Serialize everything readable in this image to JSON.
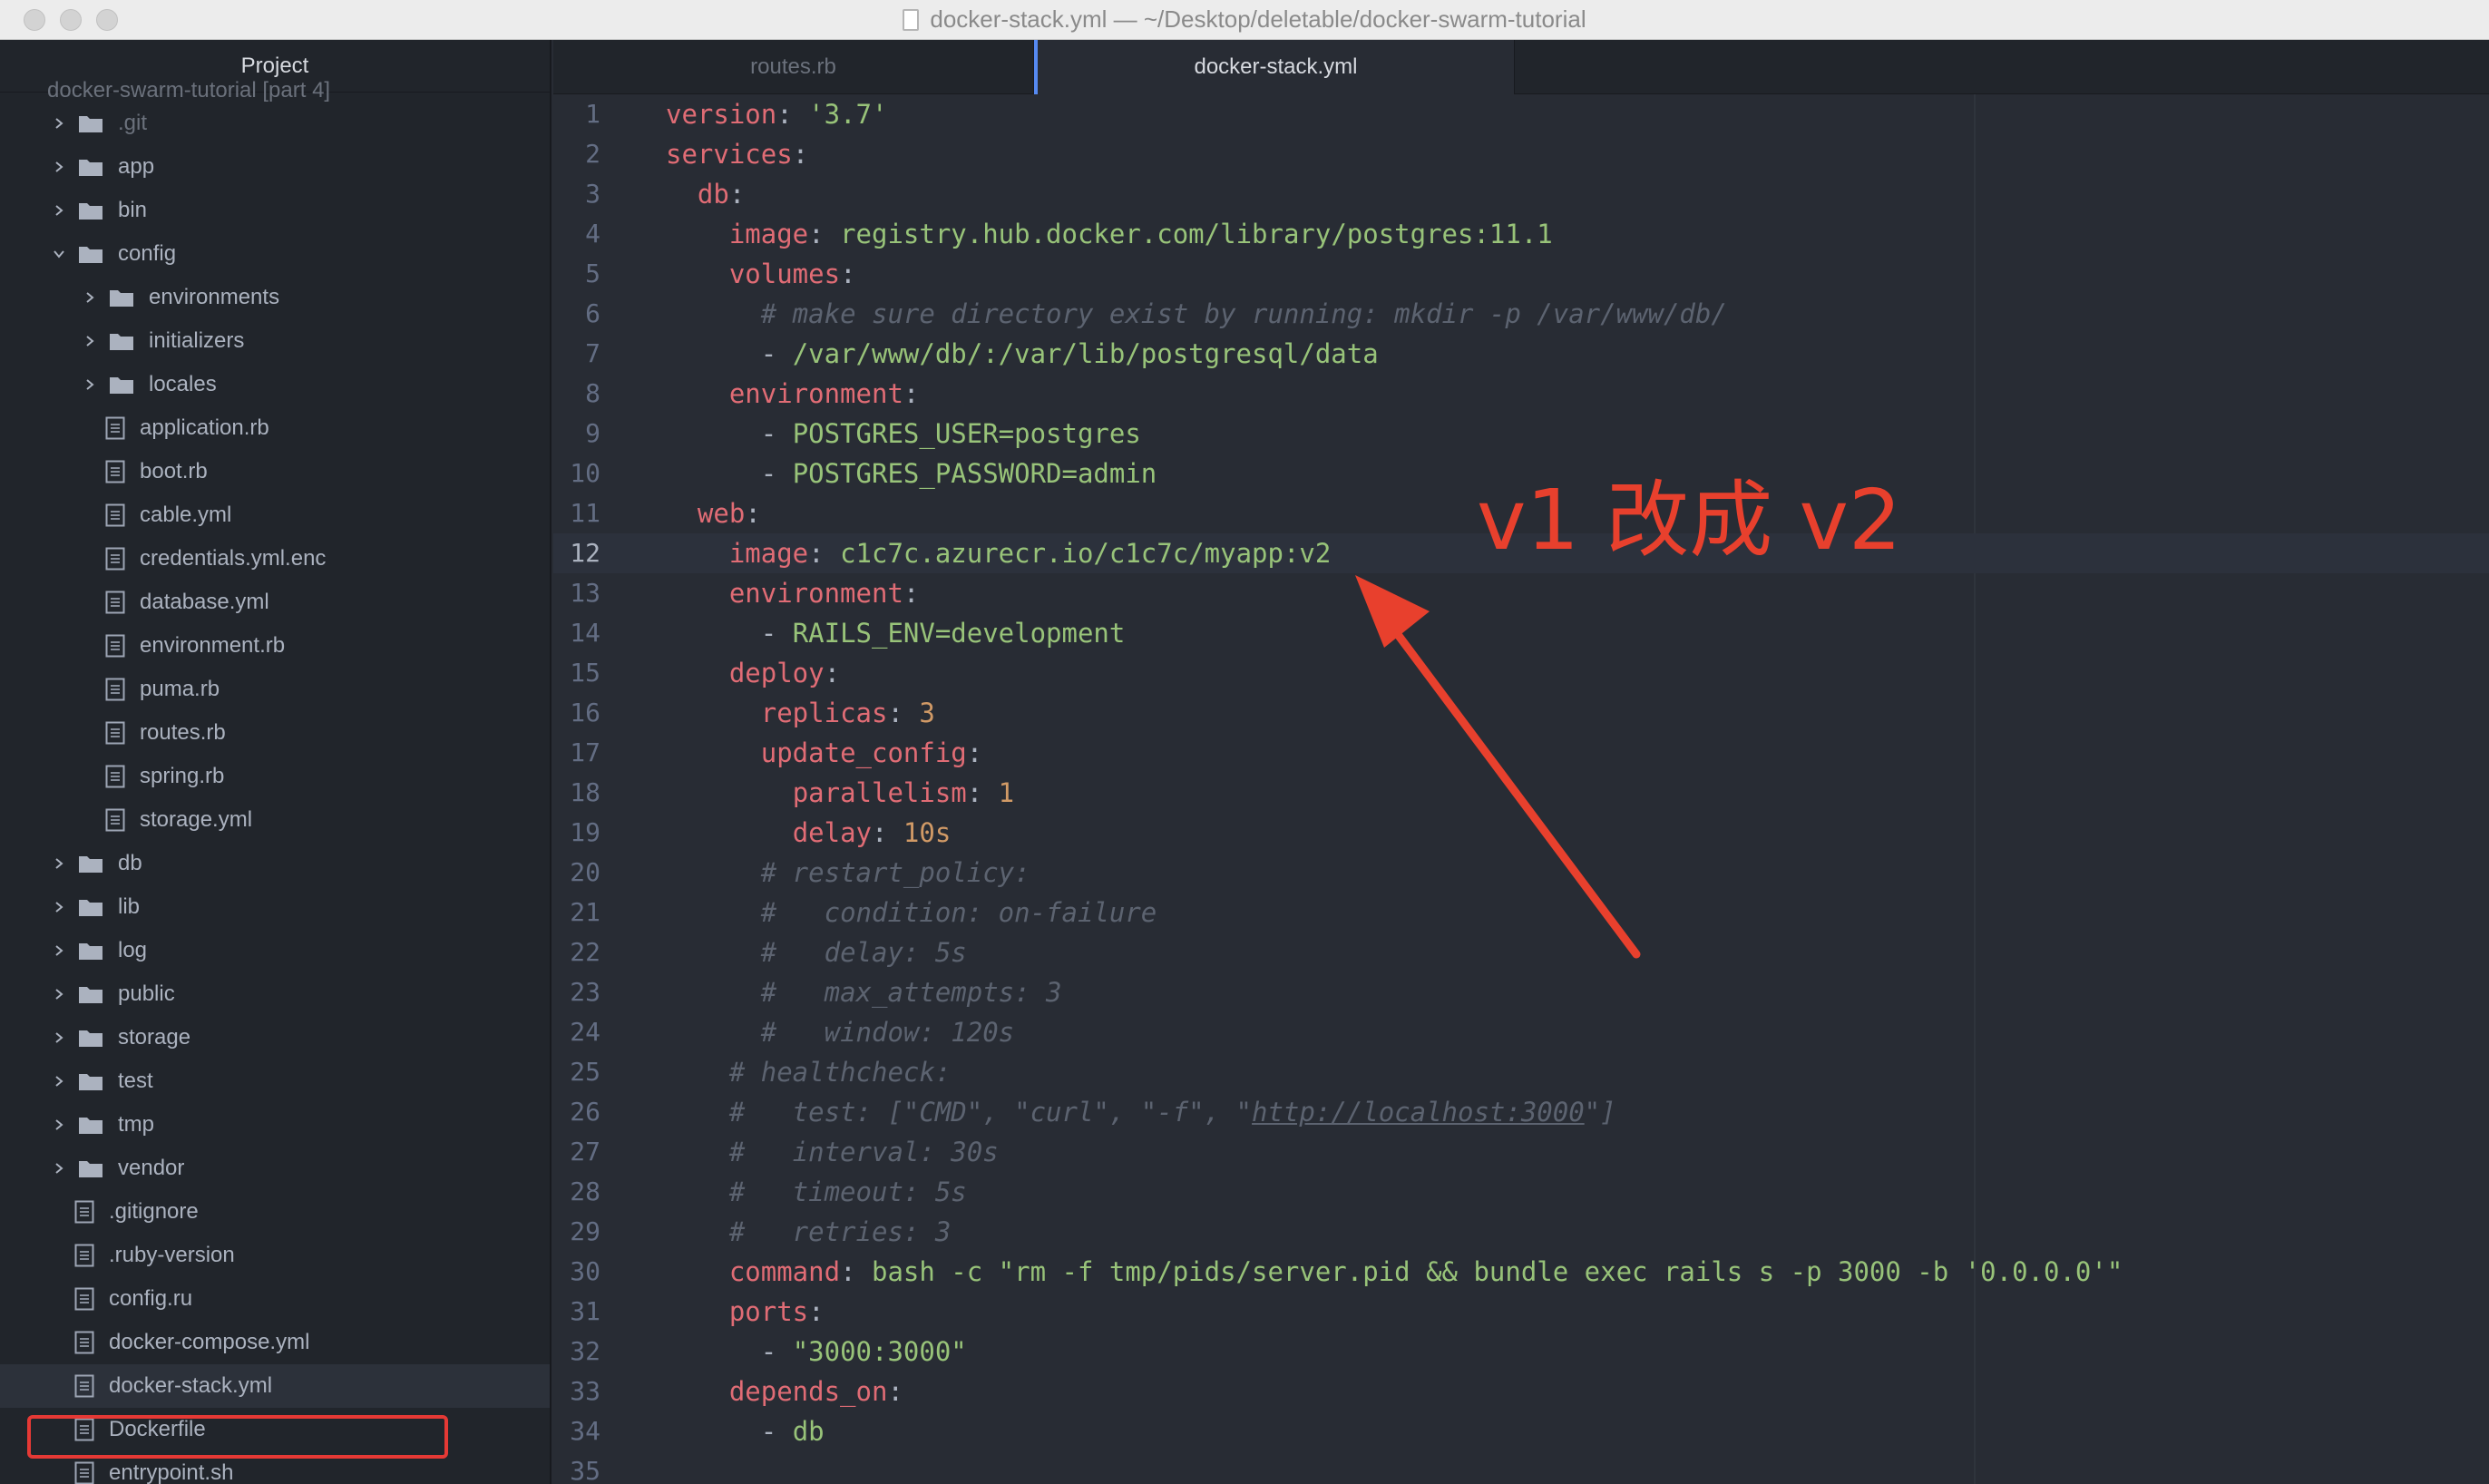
{
  "window": {
    "title": "docker-stack.yml — ~/Desktop/deletable/docker-swarm-tutorial"
  },
  "sidebar": {
    "header": "Project",
    "cutoff_label": "docker-swarm-tutorial [part 4]",
    "items": [
      {
        "label": ".git",
        "kind": "folder",
        "depth": 0,
        "expanded": false,
        "muted": true
      },
      {
        "label": "app",
        "kind": "folder",
        "depth": 0,
        "expanded": false
      },
      {
        "label": "bin",
        "kind": "folder",
        "depth": 0,
        "expanded": false
      },
      {
        "label": "config",
        "kind": "folder",
        "depth": 0,
        "expanded": true
      },
      {
        "label": "environments",
        "kind": "folder",
        "depth": 1,
        "expanded": false
      },
      {
        "label": "initializers",
        "kind": "folder",
        "depth": 1,
        "expanded": false
      },
      {
        "label": "locales",
        "kind": "folder",
        "depth": 1,
        "expanded": false
      },
      {
        "label": "application.rb",
        "kind": "file",
        "depth": 1
      },
      {
        "label": "boot.rb",
        "kind": "file",
        "depth": 1
      },
      {
        "label": "cable.yml",
        "kind": "file",
        "depth": 1
      },
      {
        "label": "credentials.yml.enc",
        "kind": "file",
        "depth": 1
      },
      {
        "label": "database.yml",
        "kind": "file",
        "depth": 1
      },
      {
        "label": "environment.rb",
        "kind": "file",
        "depth": 1
      },
      {
        "label": "puma.rb",
        "kind": "file",
        "depth": 1
      },
      {
        "label": "routes.rb",
        "kind": "file",
        "depth": 1
      },
      {
        "label": "spring.rb",
        "kind": "file",
        "depth": 1
      },
      {
        "label": "storage.yml",
        "kind": "file",
        "depth": 1
      },
      {
        "label": "db",
        "kind": "folder",
        "depth": 0,
        "expanded": false
      },
      {
        "label": "lib",
        "kind": "folder",
        "depth": 0,
        "expanded": false
      },
      {
        "label": "log",
        "kind": "folder",
        "depth": 0,
        "expanded": false
      },
      {
        "label": "public",
        "kind": "folder",
        "depth": 0,
        "expanded": false
      },
      {
        "label": "storage",
        "kind": "folder",
        "depth": 0,
        "expanded": false
      },
      {
        "label": "test",
        "kind": "folder",
        "depth": 0,
        "expanded": false
      },
      {
        "label": "tmp",
        "kind": "folder",
        "depth": 0,
        "expanded": false
      },
      {
        "label": "vendor",
        "kind": "folder",
        "depth": 0,
        "expanded": false
      },
      {
        "label": ".gitignore",
        "kind": "file",
        "depth": 0
      },
      {
        "label": ".ruby-version",
        "kind": "file",
        "depth": 0
      },
      {
        "label": "config.ru",
        "kind": "file",
        "depth": 0
      },
      {
        "label": "docker-compose.yml",
        "kind": "file",
        "depth": 0
      },
      {
        "label": "docker-stack.yml",
        "kind": "file",
        "depth": 0,
        "selected": true
      },
      {
        "label": "Dockerfile",
        "kind": "file",
        "depth": 0
      },
      {
        "label": "entrypoint.sh",
        "kind": "file",
        "depth": 0
      }
    ]
  },
  "tabs": [
    {
      "label": "routes.rb",
      "active": false
    },
    {
      "label": "docker-stack.yml",
      "active": true
    }
  ],
  "editor": {
    "cursor_line": 12,
    "lines": [
      [
        [
          "k",
          "version"
        ],
        [
          "p",
          ": "
        ],
        [
          "s",
          "'3.7'"
        ]
      ],
      [
        [
          "k",
          "services"
        ],
        [
          "p",
          ":"
        ]
      ],
      [
        [
          "p",
          "  "
        ],
        [
          "k",
          "db"
        ],
        [
          "p",
          ":"
        ]
      ],
      [
        [
          "p",
          "    "
        ],
        [
          "k",
          "image"
        ],
        [
          "p",
          ": "
        ],
        [
          "s",
          "registry.hub.docker.com/library/postgres:11.1"
        ]
      ],
      [
        [
          "p",
          "    "
        ],
        [
          "k",
          "volumes"
        ],
        [
          "p",
          ":"
        ]
      ],
      [
        [
          "p",
          "      "
        ],
        [
          "c",
          "# make sure directory exist by running: mkdir -p /var/www/db/"
        ]
      ],
      [
        [
          "p",
          "      - "
        ],
        [
          "s",
          "/var/www/db/:/var/lib/postgresql/data"
        ]
      ],
      [
        [
          "p",
          "    "
        ],
        [
          "k",
          "environment"
        ],
        [
          "p",
          ":"
        ]
      ],
      [
        [
          "p",
          "      - "
        ],
        [
          "s",
          "POSTGRES_USER=postgres"
        ]
      ],
      [
        [
          "p",
          "      - "
        ],
        [
          "s",
          "POSTGRES_PASSWORD=admin"
        ]
      ],
      [
        [
          "p",
          "  "
        ],
        [
          "k",
          "web"
        ],
        [
          "p",
          ":"
        ]
      ],
      [
        [
          "p",
          "    "
        ],
        [
          "k",
          "image"
        ],
        [
          "p",
          ": "
        ],
        [
          "s",
          "c1c7c.azurecr.io/c1c7c/myapp:v2"
        ]
      ],
      [
        [
          "p",
          "    "
        ],
        [
          "k",
          "environment"
        ],
        [
          "p",
          ":"
        ]
      ],
      [
        [
          "p",
          "      - "
        ],
        [
          "s",
          "RAILS_ENV=development"
        ]
      ],
      [
        [
          "p",
          "    "
        ],
        [
          "k",
          "deploy"
        ],
        [
          "p",
          ":"
        ]
      ],
      [
        [
          "p",
          "      "
        ],
        [
          "k",
          "replicas"
        ],
        [
          "p",
          ": "
        ],
        [
          "n",
          "3"
        ]
      ],
      [
        [
          "p",
          "      "
        ],
        [
          "k",
          "update_config"
        ],
        [
          "p",
          ":"
        ]
      ],
      [
        [
          "p",
          "        "
        ],
        [
          "k",
          "parallelism"
        ],
        [
          "p",
          ": "
        ],
        [
          "n",
          "1"
        ]
      ],
      [
        [
          "p",
          "        "
        ],
        [
          "k",
          "delay"
        ],
        [
          "p",
          ": "
        ],
        [
          "n",
          "10s"
        ]
      ],
      [
        [
          "p",
          "      "
        ],
        [
          "c",
          "# restart_policy:"
        ]
      ],
      [
        [
          "p",
          "      "
        ],
        [
          "c",
          "#   condition: on-failure"
        ]
      ],
      [
        [
          "p",
          "      "
        ],
        [
          "c",
          "#   delay: 5s"
        ]
      ],
      [
        [
          "p",
          "      "
        ],
        [
          "c",
          "#   max_attempts: 3"
        ]
      ],
      [
        [
          "p",
          "      "
        ],
        [
          "c",
          "#   window: 120s"
        ]
      ],
      [
        [
          "p",
          "    "
        ],
        [
          "c",
          "# healthcheck:"
        ]
      ],
      [
        [
          "p",
          "    "
        ],
        [
          "c",
          "#   test: [\"CMD\", \"curl\", \"-f\", \""
        ],
        [
          "cu",
          "http://localhost:3000"
        ],
        [
          "c",
          "\"]"
        ]
      ],
      [
        [
          "p",
          "    "
        ],
        [
          "c",
          "#   interval: 30s"
        ]
      ],
      [
        [
          "p",
          "    "
        ],
        [
          "c",
          "#   timeout: 5s"
        ]
      ],
      [
        [
          "p",
          "    "
        ],
        [
          "c",
          "#   retries: 3"
        ]
      ],
      [
        [
          "p",
          "    "
        ],
        [
          "k",
          "command"
        ],
        [
          "p",
          ": "
        ],
        [
          "s",
          "bash -c \"rm -f tmp/pids/server.pid && bundle exec rails s -p 3000 -b '0.0.0.0'\""
        ]
      ],
      [
        [
          "p",
          "    "
        ],
        [
          "k",
          "ports"
        ],
        [
          "p",
          ":"
        ]
      ],
      [
        [
          "p",
          "      - "
        ],
        [
          "s",
          "\"3000:3000\""
        ]
      ],
      [
        [
          "p",
          "    "
        ],
        [
          "k",
          "depends_on"
        ],
        [
          "p",
          ":"
        ]
      ],
      [
        [
          "p",
          "      - "
        ],
        [
          "s",
          "db"
        ]
      ],
      []
    ]
  },
  "annotation": {
    "text": "v1 改成 v2",
    "color": "#e8402d"
  },
  "colors": {
    "keyword": "#e06c75",
    "string": "#98c379",
    "number": "#d19a66",
    "comment": "#5c6370",
    "highlight": "#e53935"
  }
}
